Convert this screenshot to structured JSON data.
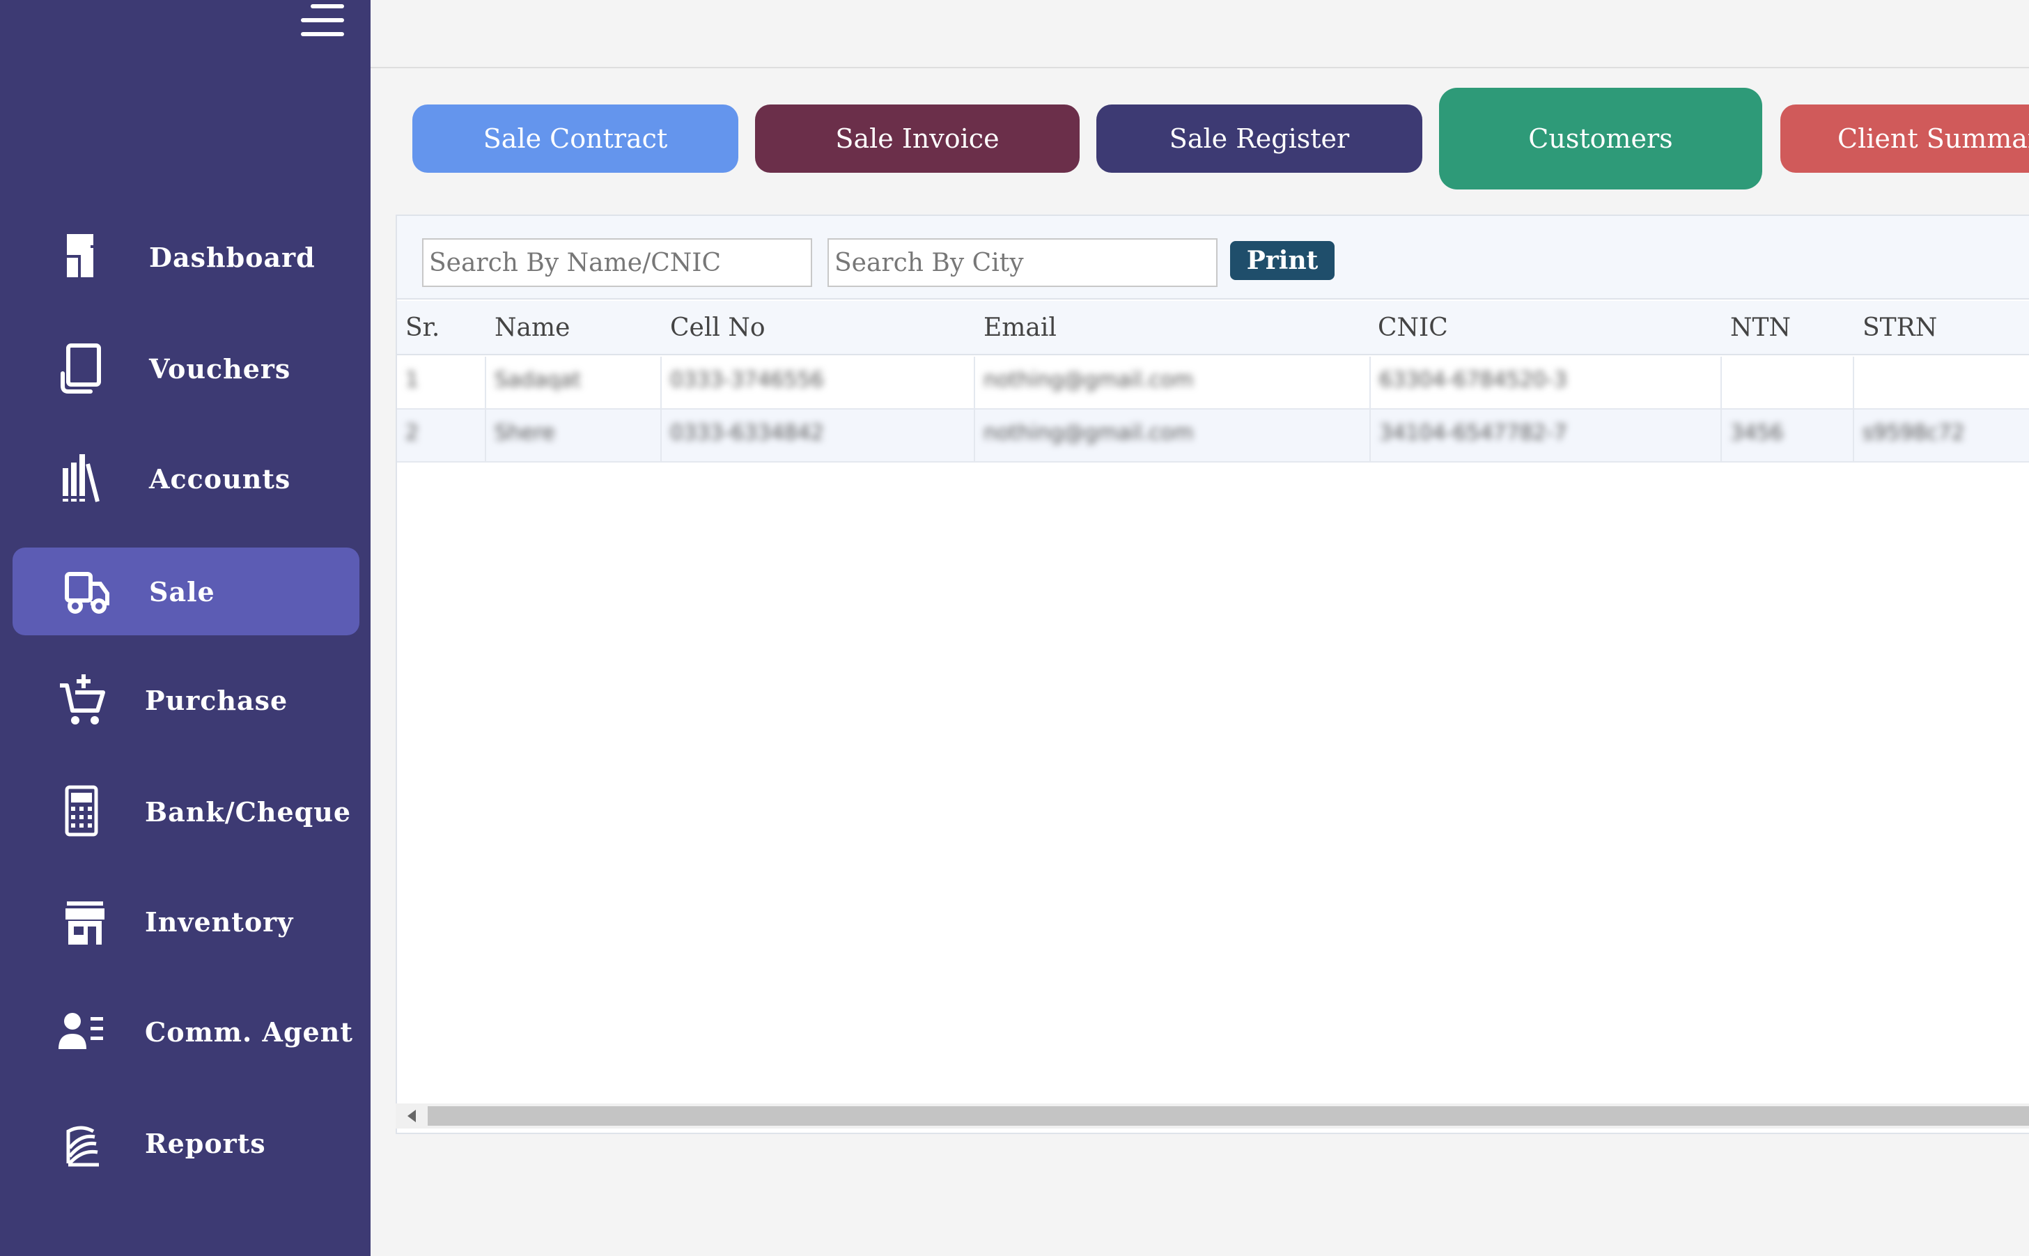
{
  "sidebar": {
    "items": [
      {
        "label": "Dashboard",
        "icon": "dashboard-icon"
      },
      {
        "label": "Vouchers",
        "icon": "voucher-icon"
      },
      {
        "label": "Accounts",
        "icon": "accounts-books-icon"
      },
      {
        "label": "Sale",
        "icon": "truck-icon",
        "active": true
      },
      {
        "label": "Purchase",
        "icon": "cart-plus-icon"
      },
      {
        "label": "Bank/Cheque",
        "icon": "calculator-icon"
      },
      {
        "label": "Inventory",
        "icon": "store-icon"
      },
      {
        "label": "Comm. Agent",
        "icon": "user-list-icon"
      },
      {
        "label": "Reports",
        "icon": "reports-icon"
      }
    ]
  },
  "tabs": [
    {
      "label": "Sale Contract",
      "color": "#6495ed"
    },
    {
      "label": "Sale Invoice",
      "color": "#6b2f4a"
    },
    {
      "label": "Sale Register",
      "color": "#3d3a73"
    },
    {
      "label": "Customers",
      "color": "#2e9a78"
    },
    {
      "label": "Client Summary",
      "color": "#d05a5a"
    }
  ],
  "filters": {
    "name_placeholder": "Search By Name/CNIC",
    "city_placeholder": "Search By City",
    "print_label": "Print"
  },
  "table": {
    "columns": [
      "Sr.",
      "Name",
      "Cell No",
      "Email",
      "CNIC",
      "NTN",
      "STRN"
    ],
    "rows": [
      [
        "1",
        "Sadaqat",
        "0333-3746556",
        "nothing@gmail.com",
        "63304-6784520-3",
        "",
        ""
      ],
      [
        "2",
        "Shere",
        "0333-6334842",
        "nothing@gmail.com",
        "34104-6547782-7",
        "3456",
        "s9598c72"
      ]
    ]
  },
  "colors": {
    "sidebar_bg": "#3d3a73",
    "sidebar_active": "#5c5cb4",
    "print_button": "#1f4e6b"
  }
}
